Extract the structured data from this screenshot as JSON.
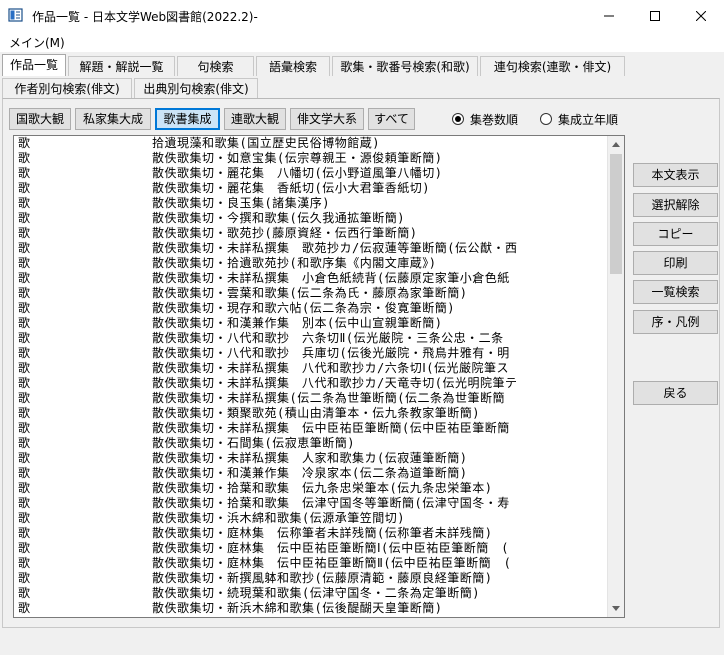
{
  "window": {
    "title": "作品一覧 - 日本文学Web図書館(2022.2)-"
  },
  "menu": {
    "main_label": "メイン(M)"
  },
  "tabs_row1": [
    {
      "label": "作品一覧",
      "active": true
    },
    {
      "label": "解題・解説一覧"
    },
    {
      "label": "句検索"
    },
    {
      "label": "語彙検索"
    },
    {
      "label": "歌集・歌番号検索(和歌)"
    },
    {
      "label": "連句検索(連歌・俳文)"
    }
  ],
  "tabs_row2": [
    {
      "label": "作者別句検索(俳文)"
    },
    {
      "label": "出典別句検索(俳文)"
    }
  ],
  "collection_buttons": [
    {
      "label": "国歌大観"
    },
    {
      "label": "私家集大成"
    },
    {
      "label": "歌書集成",
      "selected": true
    },
    {
      "label": "連歌大観"
    },
    {
      "label": "俳文学大系"
    },
    {
      "label": "すべて"
    }
  ],
  "sort_options": [
    {
      "label": "集巻数順",
      "checked": true
    },
    {
      "label": "集成立年順",
      "checked": false
    }
  ],
  "list_rows": [
    {
      "cat": "歌",
      "work": "拾遺現藻和歌集(国立歴史民俗博物館蔵)"
    },
    {
      "cat": "歌",
      "work": "散佚歌集切・如意宝集(伝宗尊親王・源俊頼筆断簡)"
    },
    {
      "cat": "歌",
      "work": "散佚歌集切・麗花集　八幡切(伝小野道風筆八幡切)"
    },
    {
      "cat": "歌",
      "work": "散佚歌集切・麗花集　香紙切(伝小大君筆香紙切)"
    },
    {
      "cat": "歌",
      "work": "散佚歌集切・良玉集(諸集漢序)"
    },
    {
      "cat": "歌",
      "work": "散佚歌集切・今撰和歌集(伝久我通拡筆断簡)"
    },
    {
      "cat": "歌",
      "work": "散佚歌集切・歌苑抄(藤原資経・伝西行筆断簡)"
    },
    {
      "cat": "歌",
      "work": "散佚歌集切・未詳私撰集　歌苑抄カ/伝寂蓮等筆断簡(伝公猷・西"
    },
    {
      "cat": "歌",
      "work": "散佚歌集切・拾遺歌苑抄(和歌序集《内閣文庫蔵》)"
    },
    {
      "cat": "歌",
      "work": "散佚歌集切・未詳私撰集　小倉色紙続背(伝藤原定家筆小倉色紙"
    },
    {
      "cat": "歌",
      "work": "散佚歌集切・雲葉和歌集(伝二条為氏・藤原為家筆断簡)"
    },
    {
      "cat": "歌",
      "work": "散佚歌集切・現存和歌六帖(伝二条為宗・俊寛筆断簡)"
    },
    {
      "cat": "歌",
      "work": "散佚歌集切・和漢兼作集　別本(伝中山宣親筆断簡)"
    },
    {
      "cat": "歌",
      "work": "散佚歌集切・八代和歌抄　六条切Ⅱ(伝光厳院・三条公忠・二条"
    },
    {
      "cat": "歌",
      "work": "散佚歌集切・八代和歌抄　兵庫切(伝後光厳院・飛鳥井雅有・明"
    },
    {
      "cat": "歌",
      "work": "散佚歌集切・未詳私撰集　八代和歌抄カ/六条切Ⅰ(伝光厳院筆ス"
    },
    {
      "cat": "歌",
      "work": "散佚歌集切・未詳私撰集　八代和歌抄カ/天竜寺切(伝光明院筆テ"
    },
    {
      "cat": "歌",
      "work": "散佚歌集切・未詳私撰集(伝二条為世筆断簡(伝二条為世筆断簡"
    },
    {
      "cat": "歌",
      "work": "散佚歌集切・類聚歌苑(積山由清筆本・伝九条教家筆断簡)"
    },
    {
      "cat": "歌",
      "work": "散佚歌集切・未詳私撰集　伝中臣祐臣筆断簡(伝中臣祐臣筆断簡"
    },
    {
      "cat": "歌",
      "work": "散佚歌集切・石間集(伝寂恵筆断簡)"
    },
    {
      "cat": "歌",
      "work": "散佚歌集切・未詳私撰集　人家和歌集カ(伝寂蓮筆断簡)"
    },
    {
      "cat": "歌",
      "work": "散佚歌集切・和漢兼作集　冷泉家本(伝二条為道筆断簡)"
    },
    {
      "cat": "歌",
      "work": "散佚歌集切・拾葉和歌集　伝九条忠栄筆本(伝九条忠栄筆本)"
    },
    {
      "cat": "歌",
      "work": "散佚歌集切・拾葉和歌集　伝津守国冬等筆断簡(伝津守国冬・寿"
    },
    {
      "cat": "歌",
      "work": "散佚歌集切・浜木綿和歌集(伝源承筆笠間切)"
    },
    {
      "cat": "歌",
      "work": "散佚歌集切・庭林集　伝称筆者未詳残簡(伝称筆者未詳残簡)"
    },
    {
      "cat": "歌",
      "work": "散佚歌集切・庭林集　伝中臣祐臣筆断簡Ⅰ(伝中臣祐臣筆断簡　("
    },
    {
      "cat": "歌",
      "work": "散佚歌集切・庭林集　伝中臣祐臣筆断簡Ⅱ(伝中臣祐臣筆断簡　("
    },
    {
      "cat": "歌",
      "work": "散佚歌集切・新撰風躰和歌抄(伝藤原清範・藤原良経筆断簡)"
    },
    {
      "cat": "歌",
      "work": "散佚歌集切・続現葉和歌集(伝津守国冬・二条為定筆断簡)"
    },
    {
      "cat": "歌",
      "work": "散佚歌集切・新浜木綿和歌集(伝後醍醐天皇筆断簡)"
    }
  ],
  "side_buttons": [
    {
      "label": "本文表示"
    },
    {
      "label": "選択解除"
    },
    {
      "label": "コピー"
    },
    {
      "label": "印刷"
    },
    {
      "label": "一覧検索"
    },
    {
      "label": "序・凡例"
    },
    {
      "label": "戻る"
    }
  ]
}
